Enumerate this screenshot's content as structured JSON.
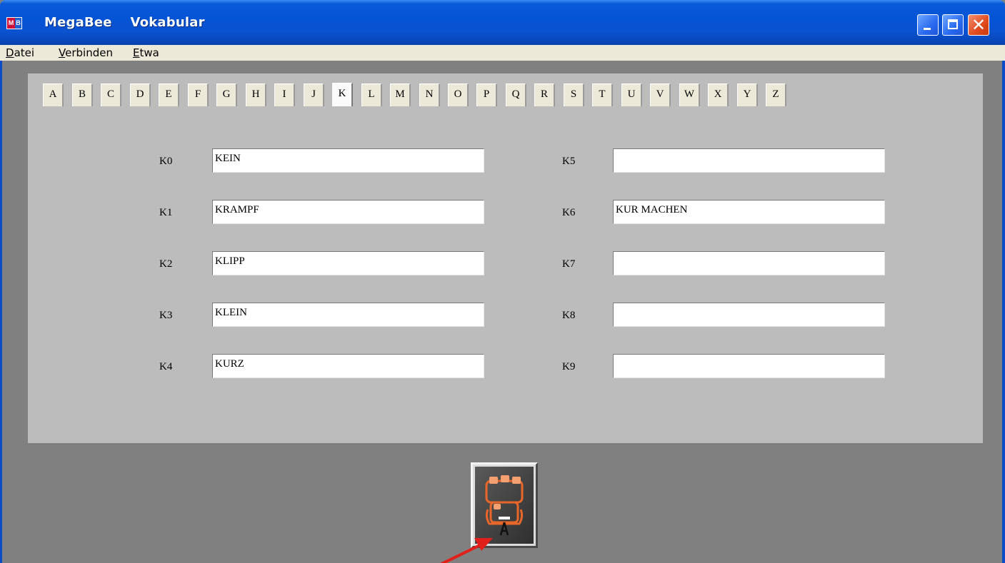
{
  "window": {
    "title": "MegaBee    Vokabular",
    "icon_m": "M",
    "icon_b": "B",
    "controls": [
      "minimize-icon",
      "maximize-icon",
      "close-icon"
    ],
    "close_glyph": "✕"
  },
  "menubar": {
    "items": [
      {
        "acc": "D",
        "rest": "atei"
      },
      {
        "acc": "V",
        "rest": "erbinden"
      },
      {
        "acc": "E",
        "rest": "twa"
      }
    ]
  },
  "tabs": {
    "letters": [
      "A",
      "B",
      "C",
      "D",
      "E",
      "F",
      "G",
      "H",
      "I",
      "J",
      "K",
      "L",
      "M",
      "N",
      "O",
      "P",
      "Q",
      "R",
      "S",
      "T",
      "U",
      "V",
      "W",
      "X",
      "Y",
      "Z"
    ],
    "active": "K"
  },
  "entries": {
    "left": [
      {
        "label": "K0",
        "value": "KEIN"
      },
      {
        "label": "K1",
        "value": "KRAMPF"
      },
      {
        "label": "K2",
        "value": "KLIPP"
      },
      {
        "label": "K3",
        "value": "KLEIN"
      },
      {
        "label": "K4",
        "value": "KURZ"
      }
    ],
    "right": [
      {
        "label": "K5",
        "value": ""
      },
      {
        "label": "K6",
        "value": "KUR MACHEN"
      },
      {
        "label": "K7",
        "value": ""
      },
      {
        "label": "K8",
        "value": ""
      },
      {
        "label": "K9",
        "value": ""
      }
    ]
  },
  "toolbar": {
    "bottom_button_icon": "connect-phone-icon"
  },
  "colors": {
    "accent_arrow": "#e0201a",
    "icon_orange": "#e8662a",
    "titlebar_blue": "#0454d6"
  }
}
